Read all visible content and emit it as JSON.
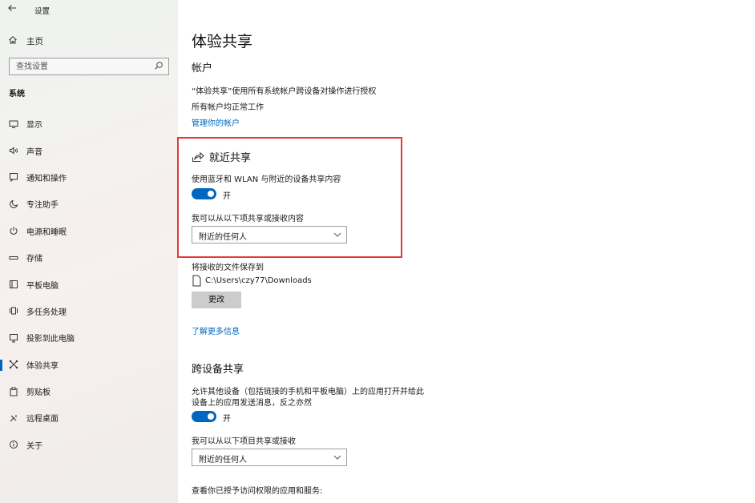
{
  "window": {
    "title": "设置",
    "back_icon": "back-arrow-icon"
  },
  "sidebar": {
    "home_label": "主页",
    "search_placeholder": "查找设置",
    "section_label": "系统",
    "items": [
      {
        "label": "显示",
        "icon": "monitor-icon",
        "active": false
      },
      {
        "label": "声音",
        "icon": "speaker-icon",
        "active": false
      },
      {
        "label": "通知和操作",
        "icon": "notification-icon",
        "active": false
      },
      {
        "label": "专注助手",
        "icon": "moon-icon",
        "active": false
      },
      {
        "label": "电源和睡眠",
        "icon": "power-icon",
        "active": false
      },
      {
        "label": "存储",
        "icon": "storage-icon",
        "active": false
      },
      {
        "label": "平板电脑",
        "icon": "tablet-icon",
        "active": false
      },
      {
        "label": "多任务处理",
        "icon": "multitask-icon",
        "active": false
      },
      {
        "label": "投影到此电脑",
        "icon": "project-icon",
        "active": false
      },
      {
        "label": "体验共享",
        "icon": "shared-experiences-icon",
        "active": true
      },
      {
        "label": "剪贴板",
        "icon": "clipboard-icon",
        "active": false
      },
      {
        "label": "远程桌面",
        "icon": "remote-desktop-icon",
        "active": false
      },
      {
        "label": "关于",
        "icon": "info-icon",
        "active": false
      }
    ],
    "accent_color": "#0067c0"
  },
  "main": {
    "title": "体验共享",
    "accounts": {
      "heading": "帐户",
      "line1": "“体验共享”使用所有系统帐户跨设备对操作进行授权",
      "line2": "所有帐户均正常工作",
      "link": "管理你的帐户"
    },
    "nearby": {
      "heading": "就近共享",
      "toggle_desc": "使用蓝牙和 WLAN 与附近的设备共享内容",
      "toggle_state": "开",
      "share_label": "我可以从以下项共享或接收内容",
      "share_value": "附近的任何人",
      "highlight_color": "#e23b3b"
    },
    "save": {
      "label": "将接收的文件保存到",
      "path": "C:\\Users\\czy77\\Downloads",
      "change_button": "更改"
    },
    "learn_more": "了解更多信息",
    "cross_device": {
      "heading": "跨设备共享",
      "desc_line1": "允许其他设备（包括链接的手机和平板电脑）上的应用打开并给此",
      "desc_line2": "设备上的应用发送消息，反之亦然",
      "toggle_state": "开",
      "share_label": "我可以从以下项目共享或接收",
      "share_value": "附近的任何人"
    },
    "permissions_label": "查看你已授予访问权限的应用和服务:"
  }
}
